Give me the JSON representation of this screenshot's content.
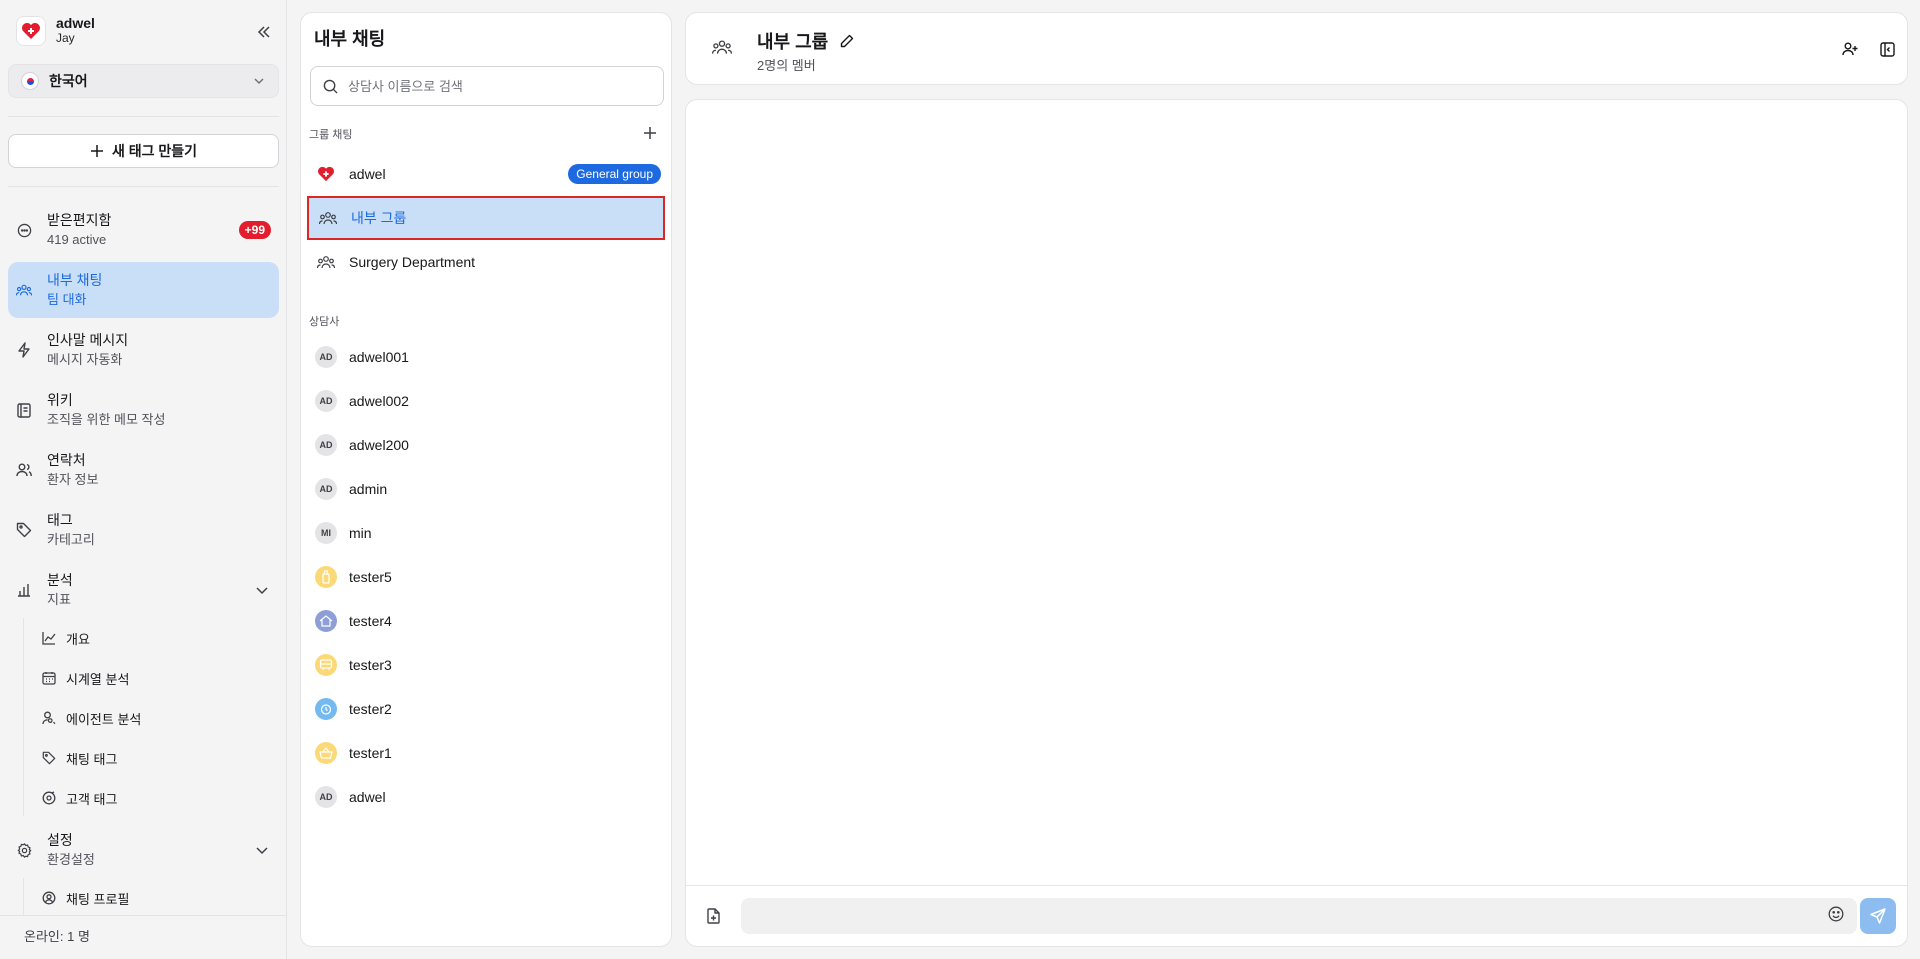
{
  "sidebar": {
    "brand_name": "adwel",
    "brand_user": "Jay",
    "language": "한국어",
    "new_tag_label": "새 태그 만들기",
    "nav": [
      {
        "title": "받은편지함",
        "sub": "419 active",
        "badge": "+99"
      },
      {
        "title": "내부 채팅",
        "sub": "팀 대화"
      },
      {
        "title": "인사말 메시지",
        "sub": "메시지 자동화"
      },
      {
        "title": "위키",
        "sub": "조직을 위한 메모 작성"
      },
      {
        "title": "연락처",
        "sub": "환자 정보"
      },
      {
        "title": "태그",
        "sub": "카테고리"
      },
      {
        "title": "분석",
        "sub": "지표"
      },
      {
        "title": "설정",
        "sub": "환경설정"
      }
    ],
    "analytics_sub": [
      "개요",
      "시계열 분석",
      "에이전트 분석",
      "채팅 태그",
      "고객 태그"
    ],
    "settings_sub": [
      "채팅 프로필"
    ],
    "online_label": "온라인:  1 명"
  },
  "middle": {
    "title": "내부 채팅",
    "search_placeholder": "상담사 이름으로 검색",
    "group_section": "그룹 채팅",
    "groups": [
      {
        "name": "adwel",
        "badge": "General group"
      },
      {
        "name": "내부 그룹"
      },
      {
        "name": "Surgery Department"
      }
    ],
    "agent_section": "상담사",
    "agents": [
      {
        "name": "adwel001",
        "initials": "AD"
      },
      {
        "name": "adwel002",
        "initials": "AD"
      },
      {
        "name": "adwel200",
        "initials": "AD"
      },
      {
        "name": "admin",
        "initials": "AD"
      },
      {
        "name": "min",
        "initials": "MI"
      },
      {
        "name": "tester5",
        "initials": ""
      },
      {
        "name": "tester4",
        "initials": ""
      },
      {
        "name": "tester3",
        "initials": ""
      },
      {
        "name": "tester2",
        "initials": ""
      },
      {
        "name": "tester1",
        "initials": ""
      },
      {
        "name": "adwel",
        "initials": "AD"
      }
    ]
  },
  "chat": {
    "title": "내부 그룹",
    "members": "2명의 멤버",
    "message_placeholder": ""
  },
  "colors": {
    "accent": "#1d6ae0",
    "active_bg": "#c9dff7",
    "badge_red": "#e11d2e",
    "selection_border": "#dc2626"
  }
}
